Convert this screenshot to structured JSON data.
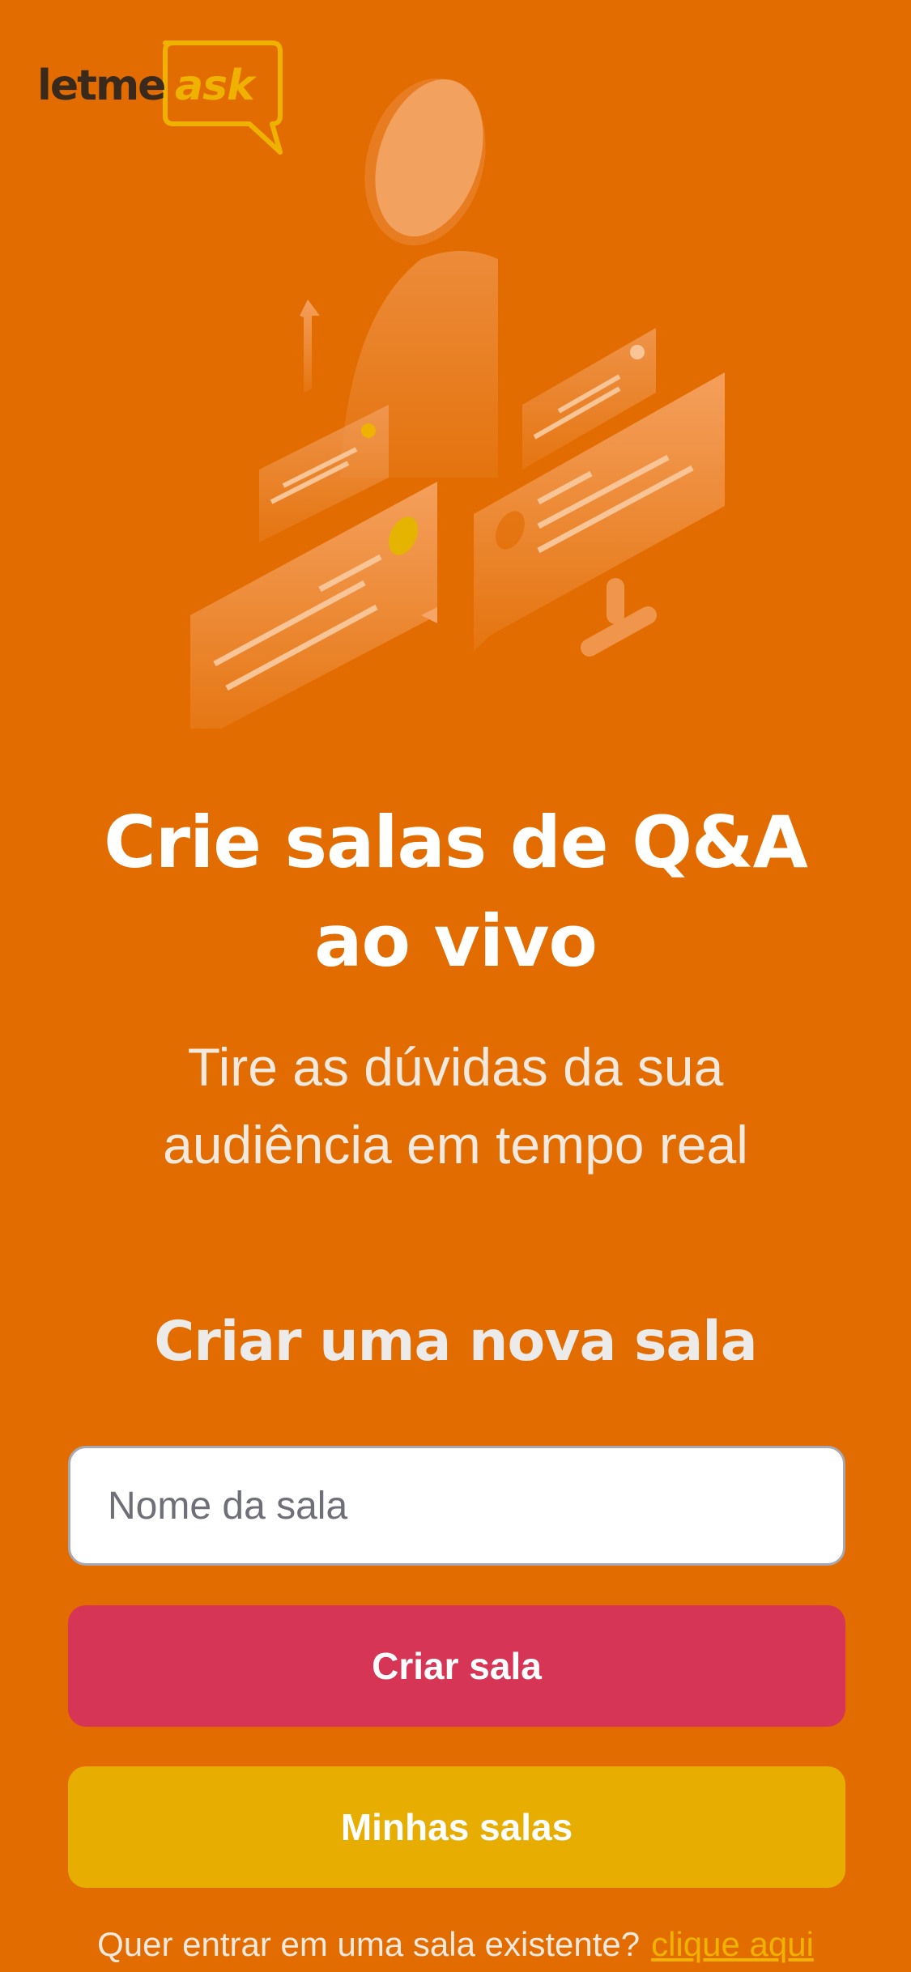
{
  "app": {
    "logo_letme": "letme",
    "logo_ask": "ask"
  },
  "hero": {
    "title_line1": "Crie salas de Q&A",
    "title_line2": "ao vivo",
    "subtitle_line1": "Tire as dúvidas da sua",
    "subtitle_line2": "audiência em tempo real"
  },
  "form": {
    "section_title": "Criar uma nova sala",
    "room_input_placeholder": "Nome da sala",
    "room_input_value": "",
    "create_button_label": "Criar sala",
    "my_rooms_button_label": "Minhas salas"
  },
  "footer": {
    "prompt": "Quer entrar em uma sala existente?",
    "link": "clique aqui"
  },
  "colors": {
    "background": "#E26C00",
    "primary_button": "#D73556",
    "secondary_button": "#E7AD00",
    "accent": "#EFB200"
  }
}
